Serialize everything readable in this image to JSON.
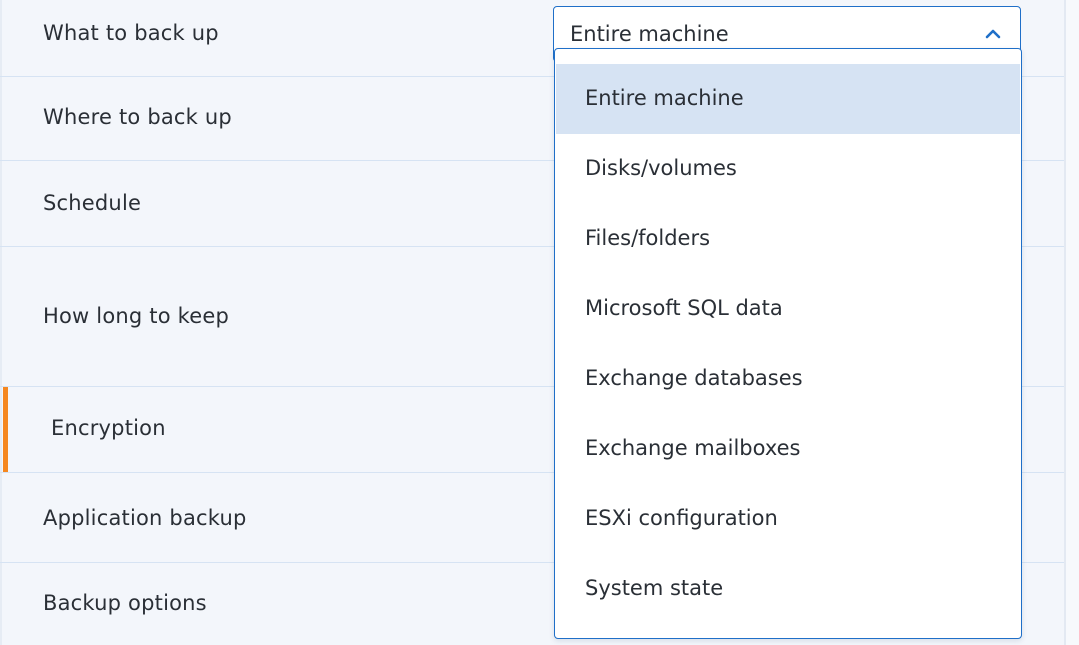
{
  "rows": [
    {
      "label": "What to back up"
    },
    {
      "label": "Where to back up"
    },
    {
      "label": "Schedule"
    },
    {
      "label": "How long to keep"
    },
    {
      "label": "Encryption"
    },
    {
      "label": "Application backup"
    },
    {
      "label": "Backup options"
    }
  ],
  "select": {
    "value": "Entire machine",
    "caret_icon": "chevron-up-icon",
    "open": true
  },
  "dropdown": {
    "options": [
      {
        "label": "Entire machine",
        "selected": true
      },
      {
        "label": "Disks/volumes",
        "selected": false
      },
      {
        "label": "Files/folders",
        "selected": false
      },
      {
        "label": "Microsoft SQL data",
        "selected": false
      },
      {
        "label": "Exchange databases",
        "selected": false
      },
      {
        "label": "Exchange mailboxes",
        "selected": false
      },
      {
        "label": "ESXi configuration",
        "selected": false
      },
      {
        "label": "System state",
        "selected": false
      }
    ]
  },
  "colors": {
    "accent": "#1f6fc8",
    "active_marker": "#f5871f",
    "selected_option_bg": "#d6e3f3",
    "panel_bg": "#f3f6fb"
  }
}
